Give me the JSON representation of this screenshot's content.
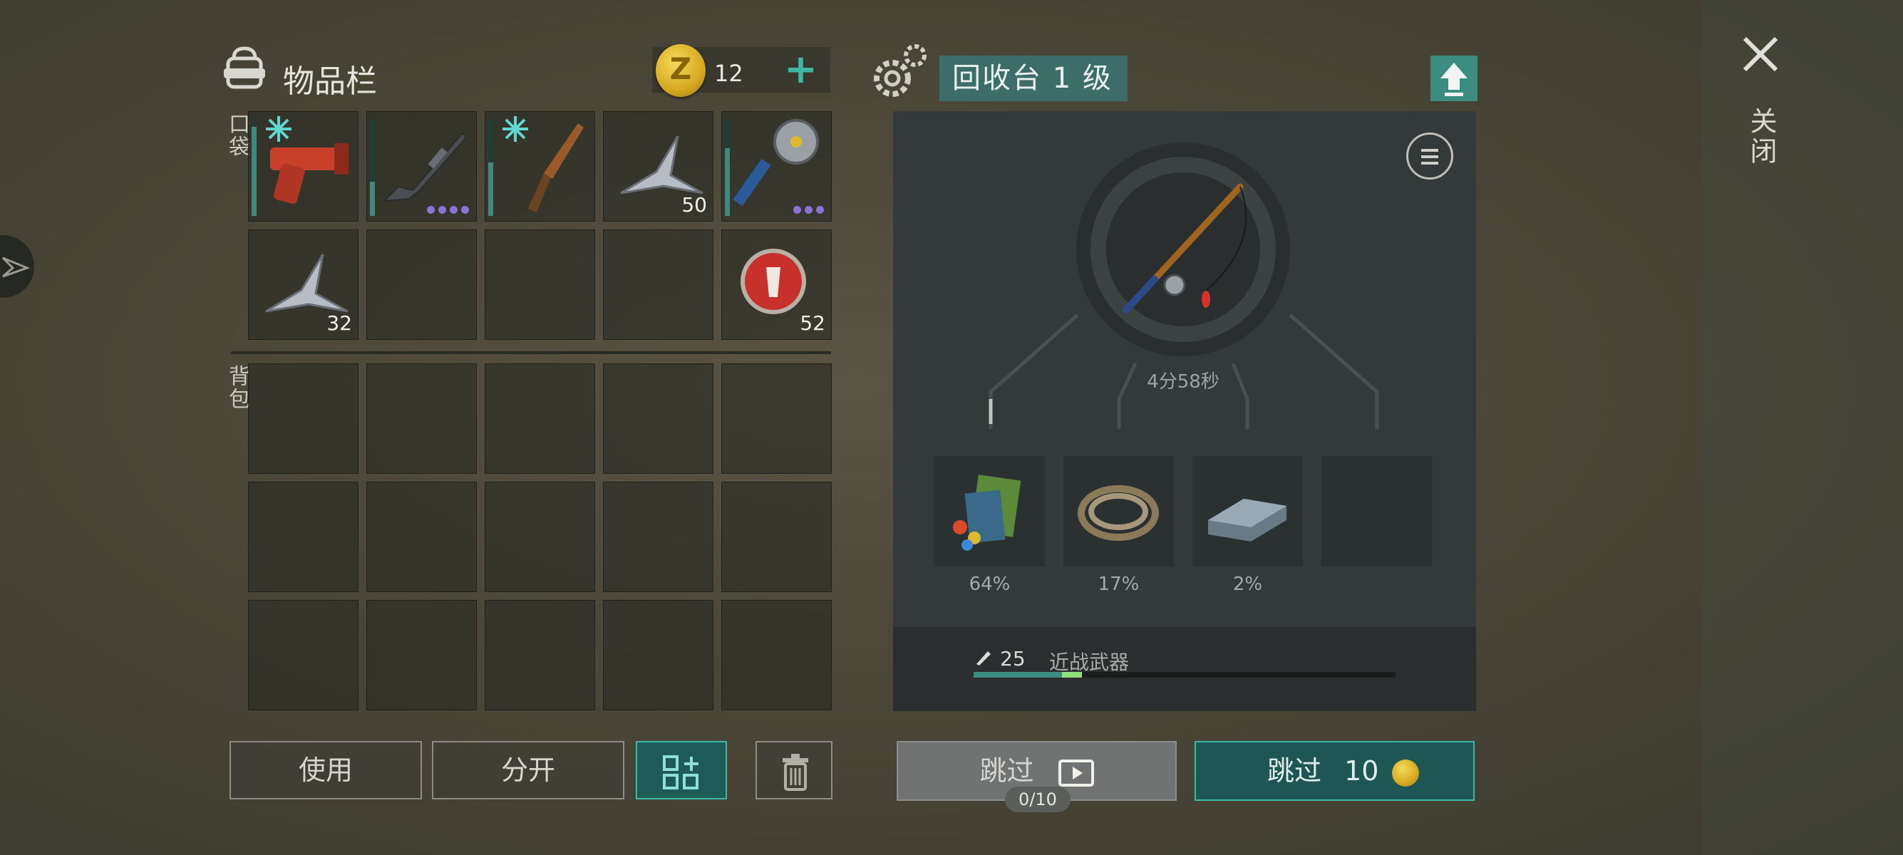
{
  "inventory": {
    "title": "物品栏",
    "coins": "12",
    "plus": "+",
    "pocket_label": "口袋",
    "backpack_label": "背包",
    "pocket_items": [
      {
        "icon": "flare-gun-icon",
        "count": "",
        "durability": 0.9,
        "frozen": true
      },
      {
        "icon": "assault-rifle-icon",
        "count": "",
        "durability": 0.35,
        "dots": 4
      },
      {
        "icon": "knife-icon",
        "count": "",
        "durability": 0.55,
        "frozen": true
      },
      {
        "icon": "metal-scrap-icon",
        "count": "50"
      },
      {
        "icon": "saw-mace-icon",
        "count": "",
        "durability": 0.7,
        "dots": 3
      },
      {
        "icon": "metal-scrap-icon",
        "count": "32"
      },
      {
        "icon": "",
        "count": ""
      },
      {
        "icon": "",
        "count": ""
      },
      {
        "icon": "",
        "count": ""
      },
      {
        "icon": "bottle-cap-icon",
        "count": "52"
      }
    ],
    "buttons": {
      "use": "使用",
      "split": "分开"
    }
  },
  "recycler": {
    "title": "回收台 1 级",
    "timer": "4分58秒",
    "item_icon": "fishing-rod-icon",
    "outputs": [
      {
        "icon": "cloth-scraps-icon",
        "pct": "64%"
      },
      {
        "icon": "rope-icon",
        "pct": "17%"
      },
      {
        "icon": "metal-ingot-icon",
        "pct": "2%"
      },
      {
        "icon": "",
        "pct": ""
      }
    ],
    "skill_level": "25",
    "skill_name": "近战武器",
    "skill_progress": 0.21,
    "skip_ad_label": "跳过",
    "ad_count": "0/10",
    "skip_coin_label": "跳过",
    "skip_coin_cost": "10"
  },
  "close_label": "关闭",
  "colors": {
    "accent": "#3fb6a8",
    "panel": "#34393a",
    "coin": "#d6a920"
  }
}
